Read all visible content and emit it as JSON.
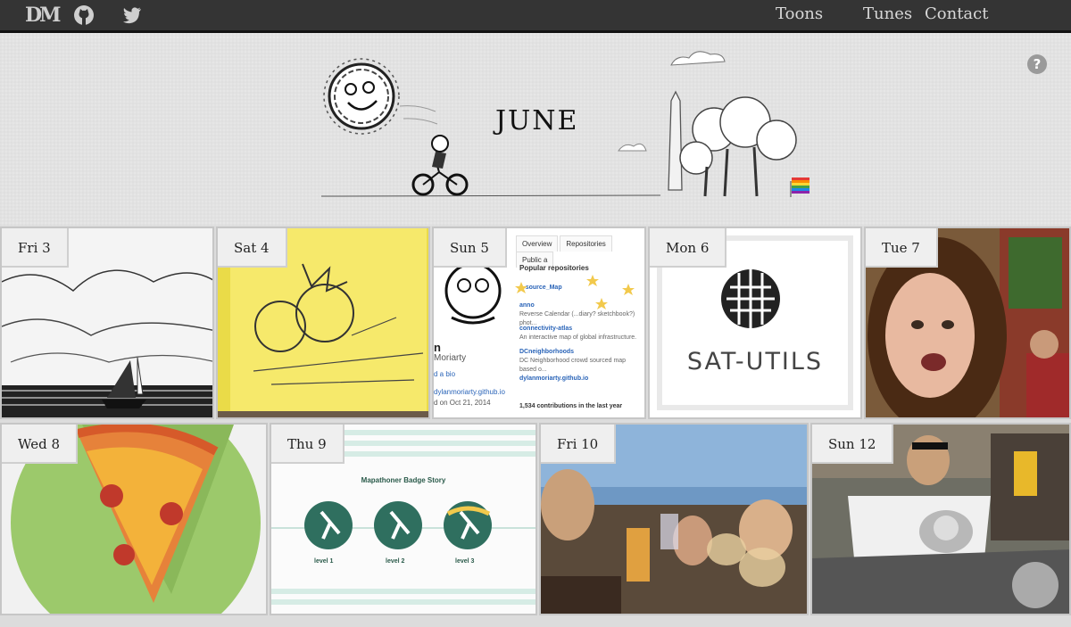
{
  "nav": {
    "logo": "DM",
    "github_icon": "github-icon",
    "twitter_icon": "twitter-icon",
    "links": [
      "Toons",
      "Tunes",
      "Contact"
    ]
  },
  "header": {
    "title": "JUNE",
    "help": "?"
  },
  "tiles": [
    {
      "day": "Fri 3",
      "kind": "sketch-sailboat"
    },
    {
      "day": "Sat 4",
      "kind": "sticky-note-drawing"
    },
    {
      "day": "Sun 5",
      "kind": "github-profile"
    },
    {
      "day": "Mon 6",
      "kind": "sat-utils-logo"
    },
    {
      "day": "Tue 7",
      "kind": "selfie-photo"
    },
    {
      "day": "Wed 8",
      "kind": "pizza-illustration"
    },
    {
      "day": "Thu 9",
      "kind": "badge-story"
    },
    {
      "day": "Fri 10",
      "kind": "toast-photo"
    },
    {
      "day": "Sun 12",
      "kind": "motorcycle-photo"
    }
  ],
  "github": {
    "tabs": [
      "Overview",
      "Repositories",
      "Public a"
    ],
    "popular": "Popular repositories",
    "repos": [
      {
        "name": "A  source_Map",
        "desc": ""
      },
      {
        "name": "anno",
        "desc": "Reverse Calendar (...diary? sketchbook?) phot..."
      },
      {
        "name": "connectivity-atlas",
        "desc": "An interactive map of global infrastructure."
      },
      {
        "name": "DCneighborhoods",
        "desc": "DC Neighborhood crowd sourced map based o..."
      },
      {
        "name": "dylanmoriarty.github.io",
        "desc": ""
      }
    ],
    "contributions": "1,534 contributions in the last year",
    "side": [
      "n",
      "Moriarty",
      "d a bio",
      "dylanmoriarty.github.io",
      "d on Oct 21, 2014"
    ]
  },
  "sat_utils": {
    "text": "SAT-UTILS"
  },
  "badge": {
    "title": "Mapathoner Badge Story",
    "levels": [
      "level 1",
      "level 2",
      "level 3"
    ]
  }
}
